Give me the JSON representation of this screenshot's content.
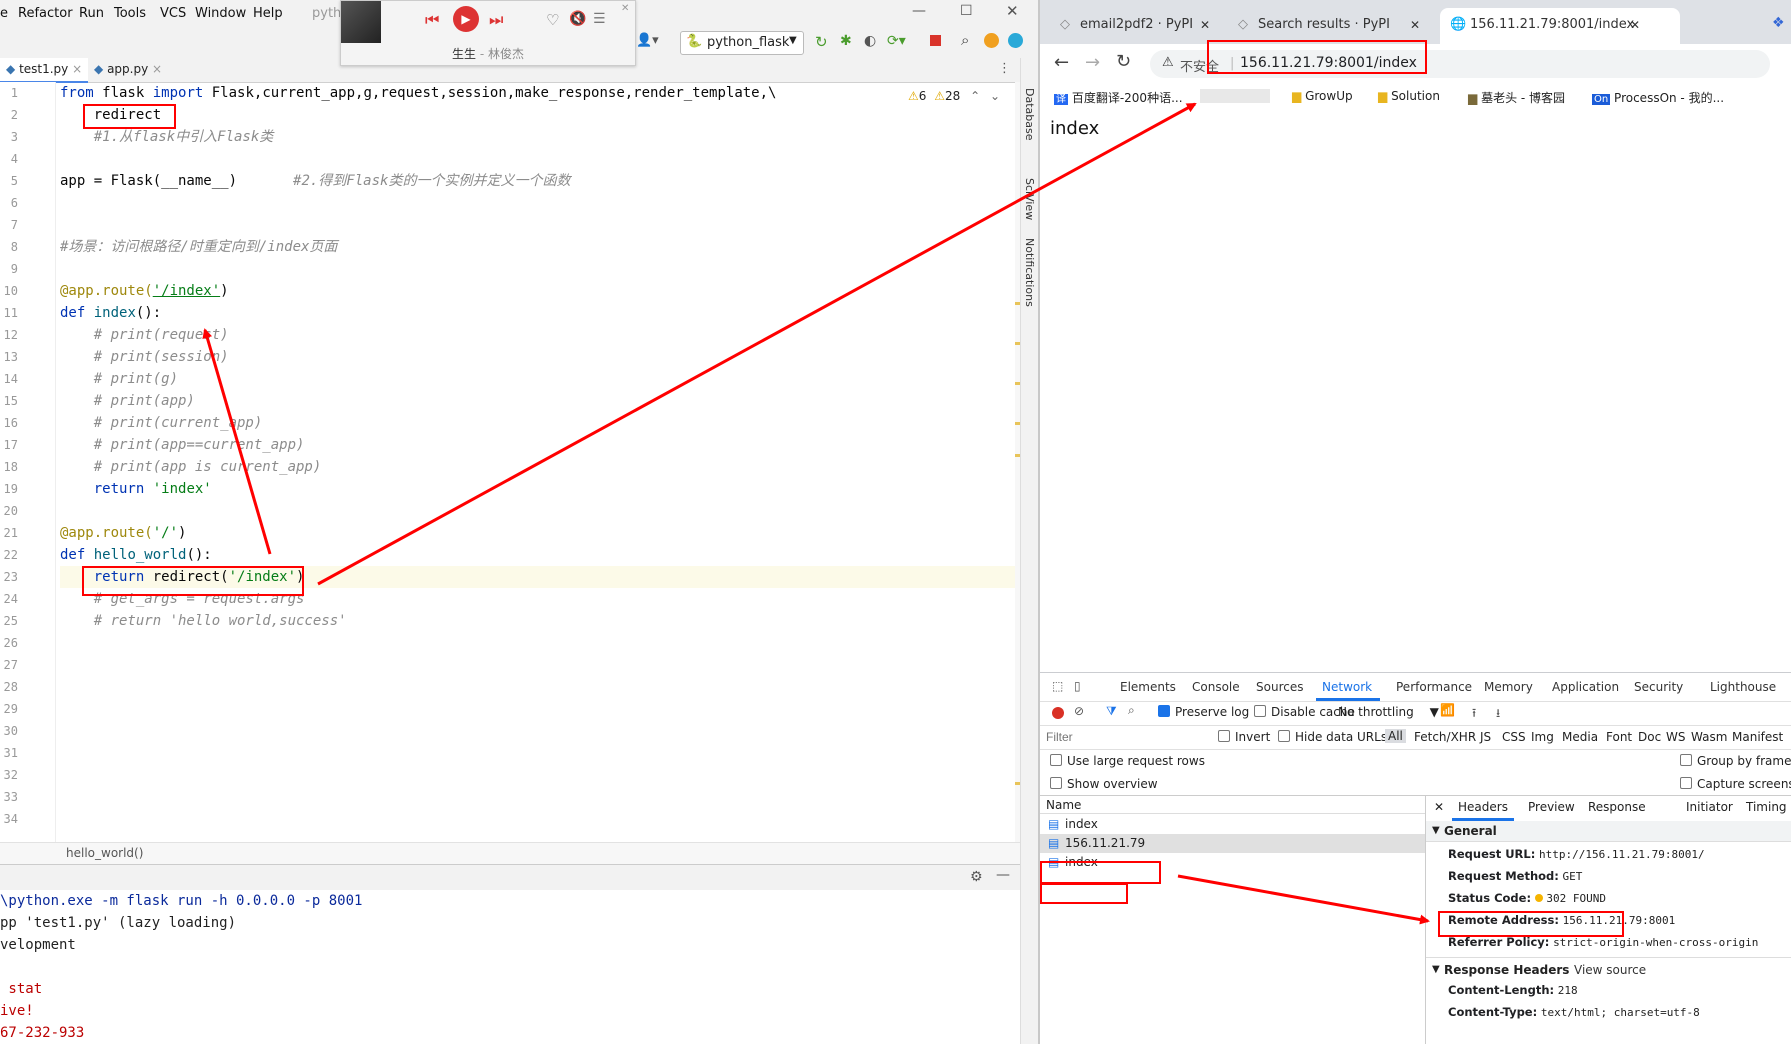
{
  "ide": {
    "menu": [
      "e",
      "Refactor",
      "Run",
      "Tools",
      "VCS",
      "Window",
      "Help",
      "pyth"
    ],
    "run_config": "python_flask",
    "tabs": [
      "test1.py",
      "app.py"
    ],
    "warnings": "6",
    "weak_warnings": "28",
    "side_labels": [
      "Database",
      "SciView",
      "Notifications"
    ],
    "line_numbers": [
      "1",
      "2",
      "3",
      "4",
      "5",
      "6",
      "7",
      "8",
      "9",
      "10",
      "11",
      "12",
      "13",
      "14",
      "15",
      "16",
      "17",
      "18",
      "19",
      "20",
      "21",
      "22",
      "23",
      "24",
      "25",
      "26",
      "27",
      "28",
      "29",
      "30",
      "31",
      "32",
      "33",
      "34"
    ],
    "code": {
      "l1_kw1": "from",
      "l1_mod": " flask ",
      "l1_kw2": "import",
      "l1_rest": " Flask,current_app,g,request,session,make_response,render_template,\\",
      "l2": "    redirect",
      "l3": "    #1.从flask中引入Flask类",
      "l5_a": "app = Flask(__name__)",
      "l5_cm": "#2.得到Flask类的一个实例并定义一个函数",
      "l8": "#场景：访问根路径/时重定向到/index页面",
      "l10_dec": "@app.route(",
      "l10_str": "'/index'",
      "l10_end": ")",
      "l11_kw": "def",
      "l11_fn": " index",
      "l11_end": "():",
      "l12": "    # print(request)",
      "l13": "    # print(session)",
      "l14": "    # print(g)",
      "l15": "    # print(app)",
      "l16": "    # print(current_app)",
      "l17": "    # print(app==current_app)",
      "l18": "    # print(app is current_app)",
      "l19_kw": "    return",
      "l19_str": " 'index'",
      "l21_dec": "@app.route(",
      "l21_str": "'/'",
      "l21_end": ")",
      "l22_kw": "def",
      "l22_fn": " hello_world",
      "l22_end": "():",
      "l23_kw": "    return",
      "l23_a": " redirect(",
      "l23_str": "'/index'",
      "l23_end": ")",
      "l24": "    # get_args = request.args",
      "l25": "    # return 'hello world,success'"
    },
    "breadcrumb": "hello_world()",
    "console": [
      "\\python.exe -m flask run -h 0.0.0.0 -p 8001",
      "pp 'test1.py' (lazy loading)",
      "velopment",
      "",
      " stat",
      "ive!",
      "67-232-933"
    ]
  },
  "music": {
    "song": "生生",
    "artist": "林俊杰",
    "separator": " - "
  },
  "browser": {
    "tabs": [
      "email2pdf2 · PyPI",
      "Search results · PyPI",
      "156.11.21.79:8001/index"
    ],
    "insecure_label": "不安全",
    "url": "156.11.21.79:8001/index",
    "bookmarks": [
      "百度翻译-200种语...",
      "GrowUp",
      "Solution",
      "墓老头 - 博客园",
      "ProcessOn - 我的..."
    ],
    "page_text": "index"
  },
  "devtools": {
    "tabs": [
      "Elements",
      "Console",
      "Sources",
      "Network",
      "Performance",
      "Memory",
      "Application",
      "Security",
      "Lighthouse"
    ],
    "preserve_log": "Preserve log",
    "disable_cache": "Disable cache",
    "throttling": "No throttling",
    "filter_placeholder": "Filter",
    "invert": "Invert",
    "hide_data_urls": "Hide data URLs",
    "types": [
      "All",
      "Fetch/XHR",
      "JS",
      "CSS",
      "Img",
      "Media",
      "Font",
      "Doc",
      "WS",
      "Wasm",
      "Manifest"
    ],
    "large_rows": "Use large request rows",
    "group_by_frame": "Group by frame",
    "show_overview": "Show overview",
    "capture_screens": "Capture screens",
    "name_header": "Name",
    "requests": [
      "index",
      "156.11.21.79",
      "index"
    ],
    "detail_tabs": [
      "Headers",
      "Preview",
      "Response",
      "Initiator",
      "Timing"
    ],
    "general_title": "General",
    "general": [
      {
        "k": "Request URL:",
        "v": "http://156.11.21.79:8001/"
      },
      {
        "k": "Request Method:",
        "v": "GET"
      },
      {
        "k": "Status Code:",
        "v": "302 FOUND"
      },
      {
        "k": "Remote Address:",
        "v": "156.11.21.79:8001"
      },
      {
        "k": "Referrer Policy:",
        "v": "strict-origin-when-cross-origin"
      }
    ],
    "response_headers_title": "Response Headers",
    "view_source": "View source",
    "response_headers": [
      {
        "k": "Content-Length:",
        "v": "218"
      },
      {
        "k": "Content-Type:",
        "v": "text/html; charset=utf-8"
      }
    ],
    "status_dot_color": "#f5b400"
  },
  "colors": {
    "annotation": "#ff0000",
    "devtools_accent": "#1a73e8"
  }
}
